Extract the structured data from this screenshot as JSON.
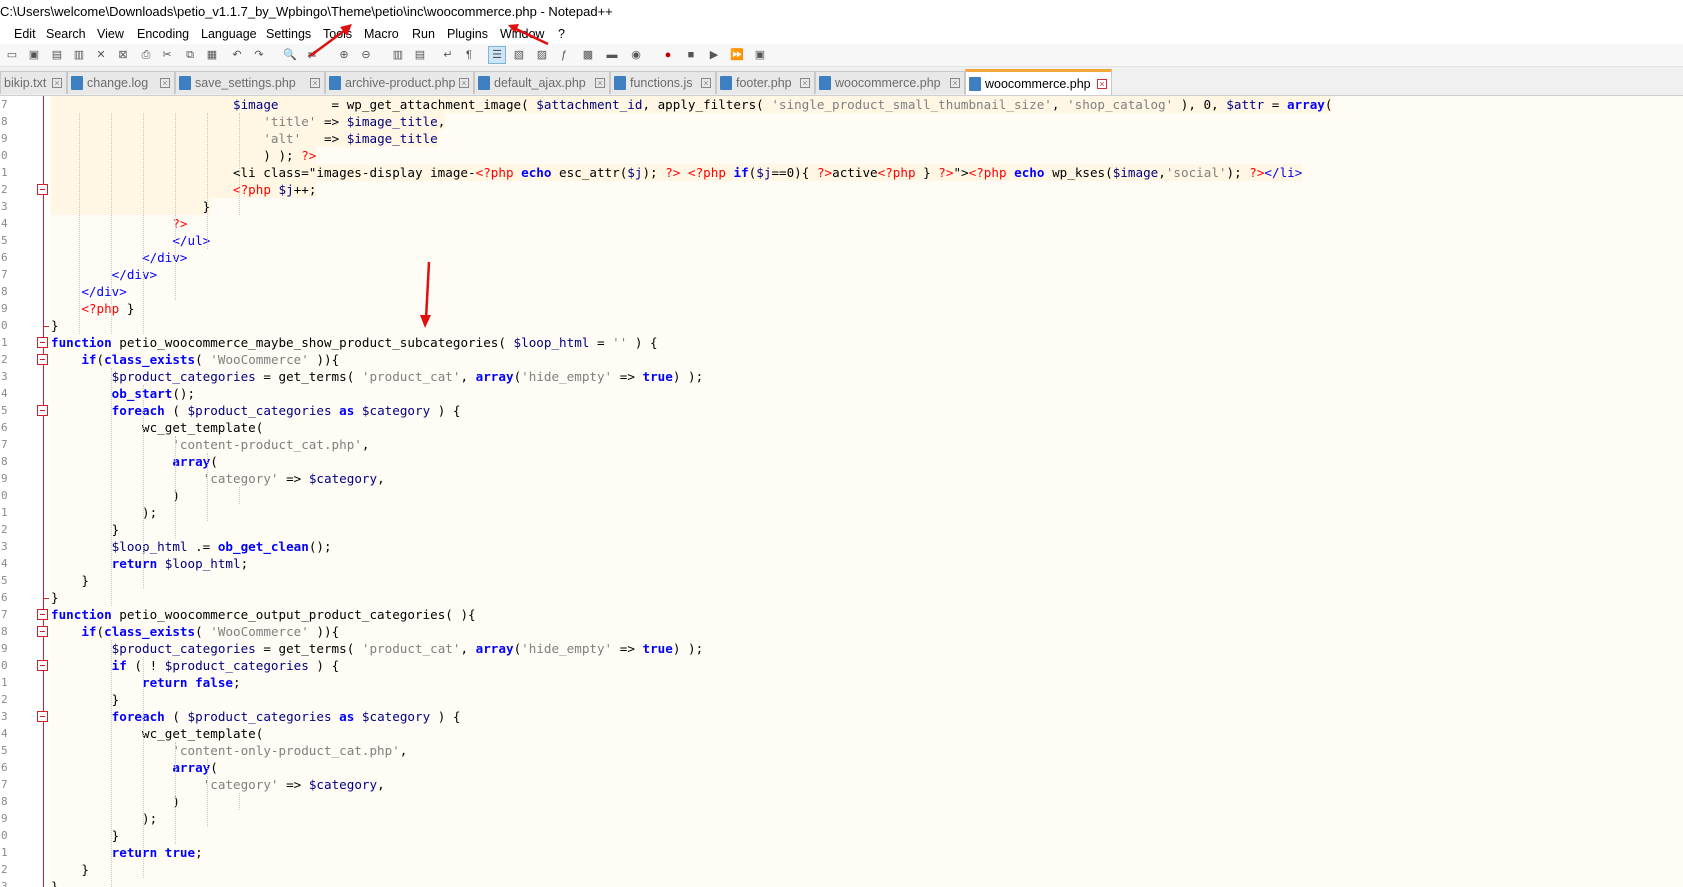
{
  "window": {
    "title": "C:\\Users\\welcome\\Downloads\\petio_v1.1.7_by_Wpbingo\\Theme\\petio\\inc\\woocommerce.php - Notepad++"
  },
  "menu": [
    "Edit",
    "Search",
    "View",
    "Encoding",
    "Language",
    "Settings",
    "Tools",
    "Macro",
    "Run",
    "Plugins",
    "Window",
    "?"
  ],
  "toolbar": {
    "icons": [
      "new-icon",
      "open-icon",
      "save-icon",
      "save-all-icon",
      "close-icon",
      "close-all-icon",
      "print-icon",
      "cut-icon",
      "copy-icon",
      "paste-icon",
      "undo-icon",
      "redo-icon",
      "find-icon",
      "replace-icon",
      "zoom-in-icon",
      "zoom-out-icon",
      "sync-v-icon",
      "sync-h-icon",
      "wrap-icon",
      "all-chars-icon",
      "indent-guide-icon",
      "udl-icon",
      "doc-map-icon",
      "func-list-icon",
      "doc-list-icon",
      "folder-icon",
      "monitor-icon",
      "record-icon",
      "stop-icon",
      "play-icon",
      "run-multi-icon",
      "save-macro-icon"
    ]
  },
  "tabs": [
    {
      "label": "bikip.txt",
      "active": false
    },
    {
      "label": "change.log",
      "active": false
    },
    {
      "label": "save_settings.php",
      "active": false
    },
    {
      "label": "archive-product.php",
      "active": false
    },
    {
      "label": "default_ajax.php",
      "active": false
    },
    {
      "label": "functions.js",
      "active": false
    },
    {
      "label": "footer.php",
      "active": false
    },
    {
      "label": "woocommerce.php",
      "active": false
    },
    {
      "label": "woocommerce.php",
      "active": true
    }
  ],
  "line_number_digits": [
    "7",
    "8",
    "9",
    "0",
    "1",
    "2",
    "3",
    "4",
    "5",
    "6",
    "7",
    "8",
    "9",
    "0",
    "1",
    "2",
    "3",
    "4",
    "5",
    "6",
    "7",
    "8",
    "9",
    "0",
    "1",
    "2",
    "3",
    "4",
    "5",
    "6",
    "7",
    "8",
    "9",
    "0",
    "1",
    "2",
    "3",
    "4",
    "5",
    "6",
    "7",
    "8",
    "9",
    "0",
    "1",
    "2",
    "3",
    "4",
    "5",
    "6",
    "7",
    "8"
  ],
  "code_lines": [
    "                        $image       = wp_get_attachment_image( $attachment_id, apply_filters( 'single_product_small_thumbnail_size', 'shop_catalog' ), 0, $attr = array(",
    "                            'title' => $image_title,",
    "                            'alt'   => $image_title",
    "                            ) ); ?>",
    "                        <li class=\"images-display image-<?php echo esc_attr($j); ?> <?php if($j==0){ ?>active<?php } ?>\"><?php echo wp_kses($image,'social'); ?></li>",
    "                        <?php $j++;",
    "                    }",
    "                ?>",
    "                </ul>",
    "            </div>",
    "        </div>",
    "    </div>",
    "    <?php }",
    "}",
    "function petio_woocommerce_maybe_show_product_subcategories( $loop_html = '' ) {",
    "    if(class_exists( 'WooCommerce' )){",
    "        $product_categories = get_terms( 'product_cat', array('hide_empty' => true) );",
    "        ob_start();",
    "        foreach ( $product_categories as $category ) {",
    "            wc_get_template(",
    "                'content-product_cat.php',",
    "                array(",
    "                    'category' => $category,",
    "                )",
    "            );",
    "        }",
    "        $loop_html .= ob_get_clean();",
    "        return $loop_html;",
    "    }",
    "}",
    "function petio_woocommerce_output_product_categories( ){",
    "    if(class_exists( 'WooCommerce' )){",
    "        $product_categories = get_terms( 'product_cat', array('hide_empty' => true) );",
    "        if ( ! $product_categories ) {",
    "            return false;",
    "        }",
    "        foreach ( $product_categories as $category ) {",
    "            wc_get_template(",
    "                'content-only-product_cat.php',",
    "                array(",
    "                    'category' => $category,",
    "                )",
    "            );",
    "        }",
    "        return true;",
    "    }",
    "}"
  ],
  "colors": {
    "editor_bg": "#fffcf5",
    "fold_margin_line": "#d0202a",
    "keyword": "#0000ff",
    "variable": "#000080",
    "string": "#808080",
    "php_tag": "#ff0000",
    "annotation_arrow": "#e01010",
    "active_tab_accent": "#f4a73a"
  }
}
